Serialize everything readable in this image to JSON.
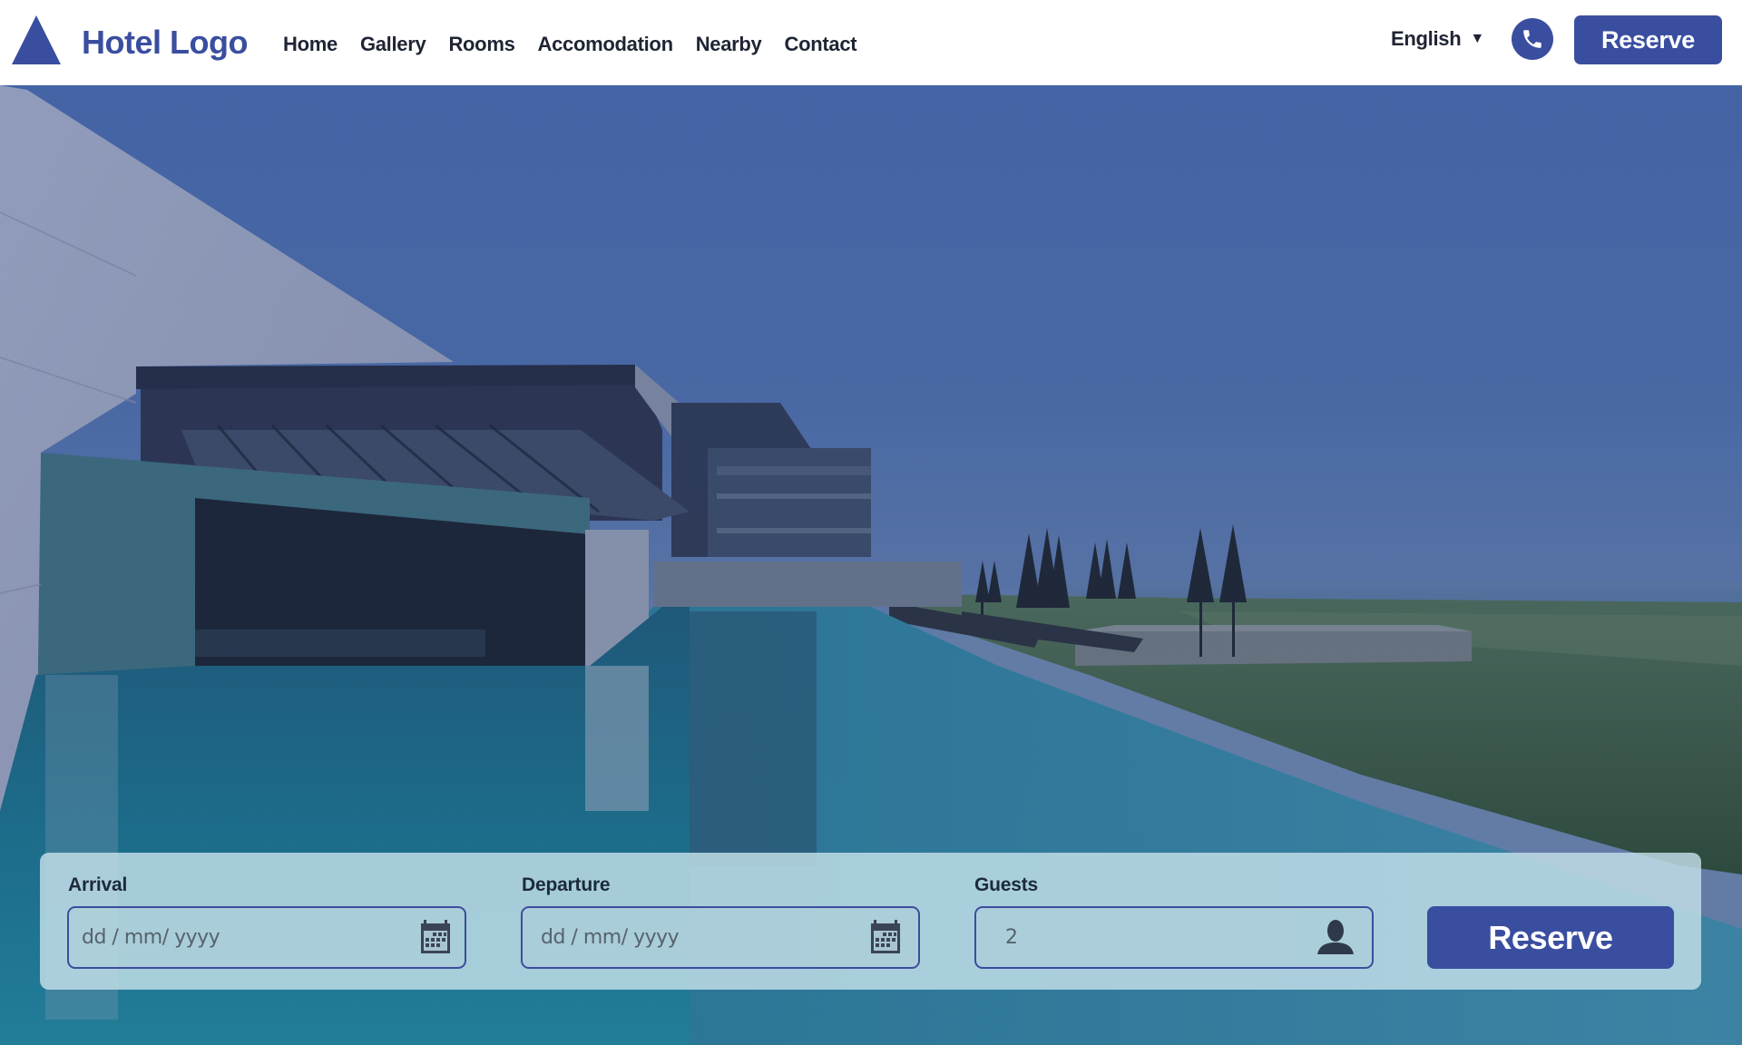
{
  "header": {
    "logo_text": "Hotel Logo",
    "nav": [
      {
        "label": "Home"
      },
      {
        "label": "Gallery"
      },
      {
        "label": "Rooms"
      },
      {
        "label": "Accomodation"
      },
      {
        "label": "Nearby"
      },
      {
        "label": "Contact"
      }
    ],
    "language": {
      "selected": "English",
      "caret": "▼"
    },
    "phone_icon": "phone-icon",
    "reserve_label": "Reserve"
  },
  "hero": {
    "image_description": "Infinity pool beside modern hotel with ocean view"
  },
  "booking": {
    "arrival": {
      "label": "Arrival",
      "placeholder": "dd / mm/ yyyy",
      "icon": "calendar-icon"
    },
    "departure": {
      "label": "Departure",
      "placeholder": "dd / mm/ yyyy",
      "icon": "calendar-icon"
    },
    "guests": {
      "label": "Guests",
      "value": "2",
      "icon": "person-icon"
    },
    "reserve_label": "Reserve"
  },
  "colors": {
    "brand": "#3a4ea0",
    "nav_text": "#1e2433",
    "panel": "#c4e0ea"
  }
}
